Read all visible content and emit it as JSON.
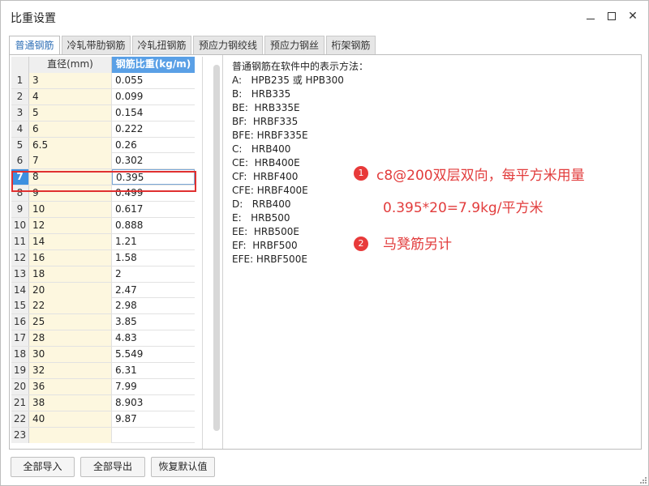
{
  "window": {
    "title": "比重设置"
  },
  "tabs": [
    {
      "label": "普通钢筋",
      "active": true
    },
    {
      "label": "冷轧带肋钢筋",
      "active": false
    },
    {
      "label": "冷轧扭钢筋",
      "active": false
    },
    {
      "label": "预应力钢绞线",
      "active": false
    },
    {
      "label": "预应力钢丝",
      "active": false
    },
    {
      "label": "桁架钢筋",
      "active": false
    }
  ],
  "grid": {
    "columns": [
      "直径(mm)",
      "钢筋比重(kg/m)"
    ],
    "selected_row": 7,
    "rows": [
      {
        "n": "1",
        "dia": "3",
        "wt": "0.055"
      },
      {
        "n": "2",
        "dia": "4",
        "wt": "0.099"
      },
      {
        "n": "3",
        "dia": "5",
        "wt": "0.154"
      },
      {
        "n": "4",
        "dia": "6",
        "wt": "0.222"
      },
      {
        "n": "5",
        "dia": "6.5",
        "wt": "0.26"
      },
      {
        "n": "6",
        "dia": "7",
        "wt": "0.302"
      },
      {
        "n": "7",
        "dia": "8",
        "wt": "0.395"
      },
      {
        "n": "8",
        "dia": "9",
        "wt": "0.499"
      },
      {
        "n": "9",
        "dia": "10",
        "wt": "0.617"
      },
      {
        "n": "10",
        "dia": "12",
        "wt": "0.888"
      },
      {
        "n": "11",
        "dia": "14",
        "wt": "1.21"
      },
      {
        "n": "12",
        "dia": "16",
        "wt": "1.58"
      },
      {
        "n": "13",
        "dia": "18",
        "wt": "2"
      },
      {
        "n": "14",
        "dia": "20",
        "wt": "2.47"
      },
      {
        "n": "15",
        "dia": "22",
        "wt": "2.98"
      },
      {
        "n": "16",
        "dia": "25",
        "wt": "3.85"
      },
      {
        "n": "17",
        "dia": "28",
        "wt": "4.83"
      },
      {
        "n": "18",
        "dia": "30",
        "wt": "5.549"
      },
      {
        "n": "19",
        "dia": "32",
        "wt": "6.31"
      },
      {
        "n": "20",
        "dia": "36",
        "wt": "7.99"
      },
      {
        "n": "21",
        "dia": "38",
        "wt": "8.903"
      },
      {
        "n": "22",
        "dia": "40",
        "wt": "9.87"
      },
      {
        "n": "23",
        "dia": "",
        "wt": ""
      }
    ]
  },
  "info": {
    "heading": "普通钢筋在软件中的表示方法：",
    "lines": [
      "A:   HPB235 或 HPB300",
      "B:   HRB335",
      "BE:  HRB335E",
      "BF:  HRBF335",
      "BFE: HRBF335E",
      "C:   HRB400",
      "CE:  HRB400E",
      "CF:  HRBF400",
      "CFE: HRBF400E",
      "D:   RRB400",
      "E:   HRB500",
      "EE:  HRB500E",
      "EF:  HRBF500",
      "EFE: HRBF500E"
    ]
  },
  "annotations": {
    "badge1": "1",
    "note1_line1": "c8@200双层双向，每平方米用量",
    "note1_line2": "0.395*20=7.9kg/平方米",
    "badge2": "2",
    "note2": "马凳筋另计",
    "color": "#e23c3c"
  },
  "footer": {
    "import_all": "全部导入",
    "export_all": "全部导出",
    "restore_default": "恢复默认值"
  }
}
